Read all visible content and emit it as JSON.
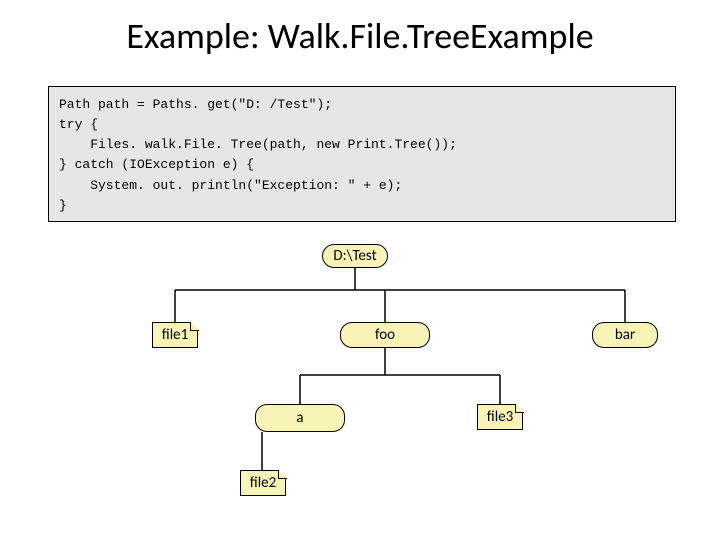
{
  "title": "Example: Walk.File.TreeExample",
  "code": "Path path = Paths. get(\"D: /Test\");\ntry {\n    Files. walk.File. Tree(path, new Print.Tree());\n} catch (IOException e) {\n    System. out. println(\"Exception: \" + e);\n}",
  "tree": {
    "root": "D:\\Test",
    "file1": "file1",
    "foo": "foo",
    "bar": "bar",
    "a": "a",
    "file3": "file3",
    "file2": "file2"
  }
}
